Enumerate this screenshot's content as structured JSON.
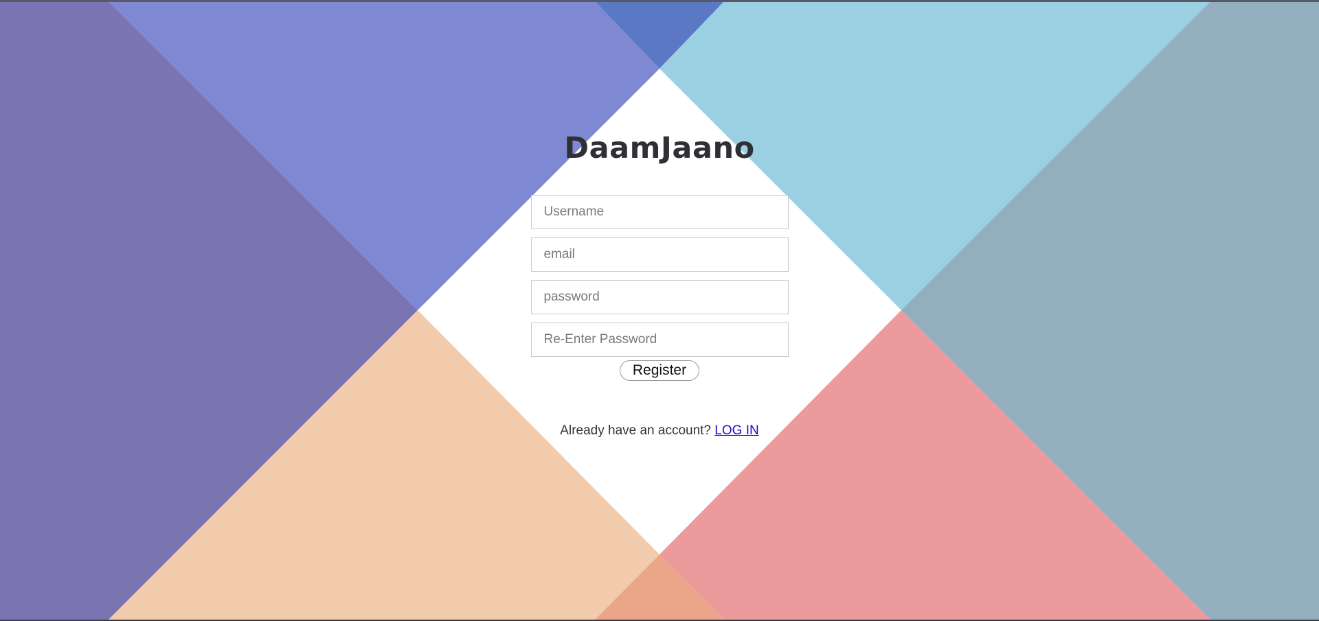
{
  "brand": {
    "title": "DaamJaano"
  },
  "form": {
    "username_placeholder": "Username",
    "email_placeholder": "email",
    "password_placeholder": "password",
    "reenter_placeholder": "Re-Enter Password",
    "register_label": "Register"
  },
  "footer": {
    "prompt": "Already have an account?",
    "login_label": "LOG IN"
  },
  "colors": {
    "purple_left": "#7b74b2",
    "periwinkle": "#7f88d2",
    "top_blue": "#5a78c4",
    "sky_blue": "#9bd0e3",
    "slate_blue": "#93aebf",
    "peach": "#f2cbad",
    "salmon_pink": "#ec9a9c",
    "bottom_orange": "#eba68a",
    "link": "#1a0dcc"
  }
}
